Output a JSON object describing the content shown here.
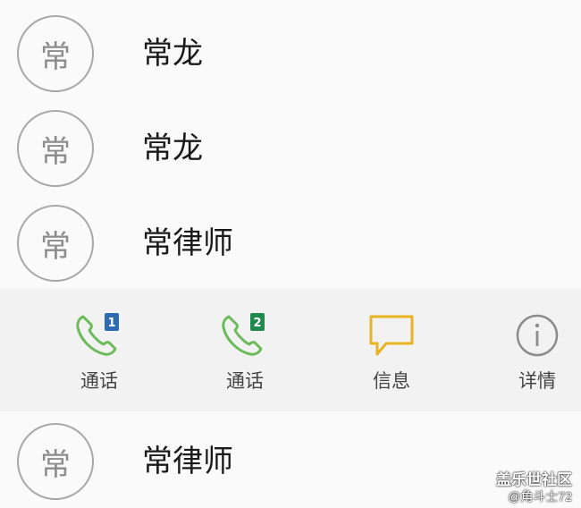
{
  "contacts": [
    {
      "avatar": "常",
      "name": "常龙"
    },
    {
      "avatar": "常",
      "name": "常龙"
    },
    {
      "avatar": "常",
      "name": "常律师"
    },
    {
      "avatar": "常",
      "name": "常律师"
    }
  ],
  "actions": [
    {
      "label": "通话",
      "icon": "phone-sim1-icon",
      "sim": "1",
      "color": "#6cbb5a",
      "badge_color": "#2e6bb3"
    },
    {
      "label": "通话",
      "icon": "phone-sim2-icon",
      "sim": "2",
      "color": "#6cbb5a",
      "badge_color": "#1f8a4c"
    },
    {
      "label": "信息",
      "icon": "message-icon",
      "color": "#e8b422"
    },
    {
      "label": "详情",
      "icon": "info-icon",
      "color": "#8c8c8c"
    }
  ],
  "watermark": {
    "title": "盖乐世社区",
    "subtitle": "@角斗士72"
  }
}
